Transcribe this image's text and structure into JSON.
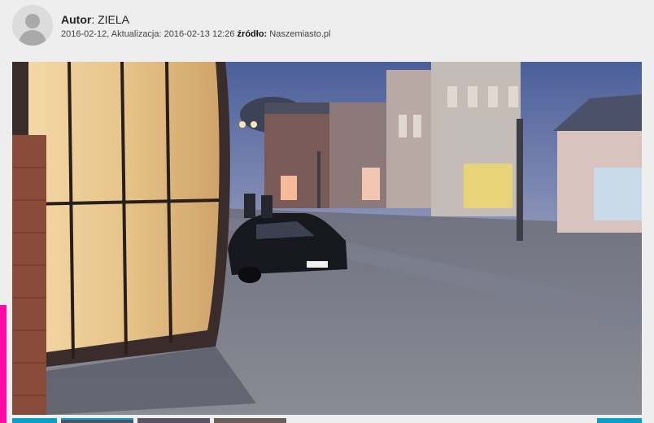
{
  "author": {
    "label": "Autor",
    "separator": ": ",
    "name": "ZIELA"
  },
  "meta": {
    "created": "2016-02-12",
    "separator": ", ",
    "updated_label": "Aktualizacja:",
    "updated": "2016-02-13 12:26",
    "source_label": "źródło:",
    "source": "Naszemiasto.pl"
  },
  "icons": {
    "avatar": "default-user-avatar-icon"
  },
  "colors": {
    "accent": "#0a9fc4",
    "side_bar": "#ff0aa6"
  }
}
